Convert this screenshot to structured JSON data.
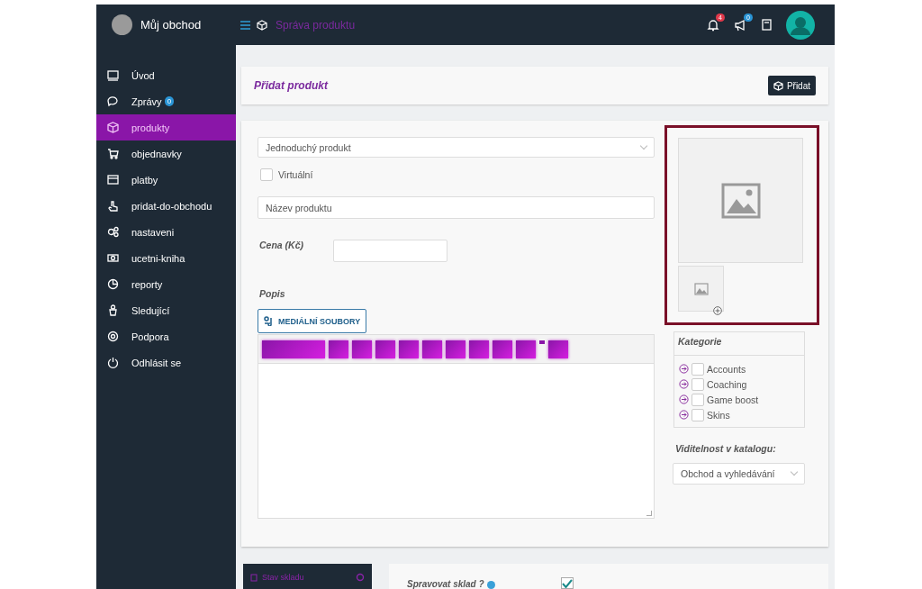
{
  "header": {
    "shop_name": "Můj obchod",
    "breadcrumb": "Správa produktu",
    "bell_badge": "4",
    "megaphone_badge": "0"
  },
  "sidebar": {
    "items": [
      {
        "label": "Úvod",
        "selected": false
      },
      {
        "label": "Zprávy",
        "badge": "0",
        "selected": false
      },
      {
        "label": "produkty",
        "selected": true
      },
      {
        "label": "objednavky",
        "selected": false
      },
      {
        "label": "platby",
        "selected": false
      },
      {
        "label": "pridat-do-obchodu",
        "selected": false
      },
      {
        "label": "nastaveni",
        "selected": false
      },
      {
        "label": "ucetni-kniha",
        "selected": false
      },
      {
        "label": "reporty",
        "selected": false
      },
      {
        "label": "Sledující",
        "selected": false
      },
      {
        "label": "Podpora",
        "selected": false
      },
      {
        "label": "Odhlásit se",
        "selected": false
      }
    ]
  },
  "page_title": "Přidat produkt",
  "add_button": "Přidat",
  "form": {
    "product_type": "Jednoduchý produkt",
    "virtual": {
      "label": "Virtuální",
      "checked": false
    },
    "name_placeholder": "Název produktu",
    "price_label": "Cena (Kč)",
    "description_label": "Popis",
    "media_button": "MEDIÁLNÍ SOUBORY"
  },
  "categories": {
    "title": "Kategorie",
    "items": [
      {
        "label": "Accounts",
        "checked": false
      },
      {
        "label": "Coaching",
        "checked": false
      },
      {
        "label": "Game boost",
        "checked": false
      },
      {
        "label": "Skins",
        "checked": false
      }
    ]
  },
  "visibility": {
    "label": "Viditelnost v katalogu:",
    "value": "Obchod a vyhledávání"
  },
  "stock": {
    "tab": "Stav skladu",
    "manage_label": "Spravovat sklad ?",
    "manage_checked": true
  }
}
